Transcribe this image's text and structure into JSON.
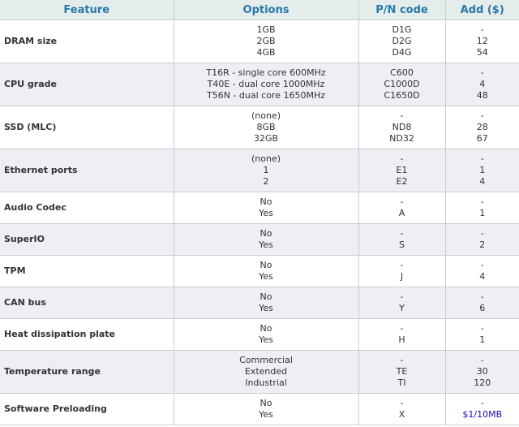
{
  "table": {
    "headers": [
      "Feature",
      "Options",
      "P/N code",
      "Add ($)"
    ],
    "rows": [
      {
        "feature": "DRAM size",
        "options": [
          "1GB",
          "2GB",
          "4GB"
        ],
        "pn": [
          "D1G",
          "D2G",
          "D4G"
        ],
        "add": [
          "-",
          "12",
          "54"
        ]
      },
      {
        "feature": "CPU grade",
        "options": [
          "T16R - single core 600MHz",
          "T40E - dual core 1000MHz",
          "T56N - dual core 1650MHz"
        ],
        "pn": [
          "C600",
          "C1000D",
          "C1650D"
        ],
        "add": [
          "-",
          "4",
          "48"
        ]
      },
      {
        "feature": "SSD (MLC)",
        "options": [
          "(none)",
          "8GB",
          "32GB"
        ],
        "pn": [
          "-",
          "ND8",
          "ND32"
        ],
        "add": [
          "-",
          "28",
          "67"
        ]
      },
      {
        "feature": "Ethernet ports",
        "options": [
          "(none)",
          "1",
          "2"
        ],
        "pn": [
          "-",
          "E1",
          "E2"
        ],
        "add": [
          "-",
          "1",
          "4"
        ]
      },
      {
        "feature": "Audio Codec",
        "options": [
          "No",
          "Yes"
        ],
        "pn": [
          "-",
          "A"
        ],
        "add": [
          "-",
          "1"
        ]
      },
      {
        "feature": "SuperIO",
        "options": [
          "No",
          "Yes"
        ],
        "pn": [
          "-",
          "S"
        ],
        "add": [
          "-",
          "2"
        ]
      },
      {
        "feature": "TPM",
        "options": [
          "No",
          "Yes"
        ],
        "pn": [
          "-",
          "J"
        ],
        "add": [
          "-",
          "4"
        ]
      },
      {
        "feature": "CAN bus",
        "options": [
          "No",
          "Yes"
        ],
        "pn": [
          "-",
          "Y"
        ],
        "add": [
          "-",
          "6"
        ]
      },
      {
        "feature": "Heat dissipation plate",
        "options": [
          "No",
          "Yes"
        ],
        "pn": [
          "-",
          "H"
        ],
        "add": [
          "-",
          "1"
        ]
      },
      {
        "feature": "Temperature range",
        "options": [
          "Commercial",
          "Extended",
          "Industrial"
        ],
        "pn": [
          "-",
          "TE",
          "TI"
        ],
        "add": [
          "-",
          "30",
          "120"
        ]
      },
      {
        "feature": "Software Preloading",
        "options": [
          "No",
          "Yes"
        ],
        "pn": [
          "-",
          "X"
        ],
        "add": [
          "-",
          "$1/10MB"
        ]
      }
    ]
  },
  "colors": {
    "header_text": "#2a78aa",
    "header_bg": "#e4ecec",
    "alt_row_bg": "#eeeef5",
    "link": "#1a10c0"
  }
}
